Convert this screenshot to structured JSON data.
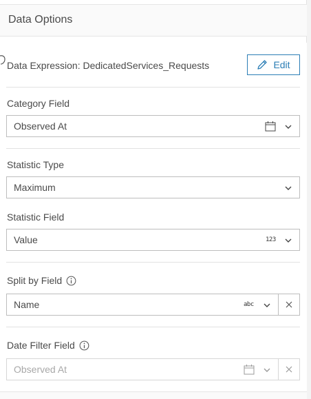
{
  "panel": {
    "title": "Data Options"
  },
  "expression": {
    "label": "Data Expression: DedicatedServices_Requests",
    "edit_label": "Edit"
  },
  "category_field": {
    "label": "Category Field",
    "value": "Observed At",
    "type_icon": "calendar-icon"
  },
  "statistic_type": {
    "label": "Statistic Type",
    "value": "Maximum"
  },
  "statistic_field": {
    "label": "Statistic Field",
    "value": "Value",
    "type_badge": "123"
  },
  "split_by_field": {
    "label": "Split by Field",
    "value": "Name",
    "type_badge": "abc"
  },
  "date_filter_field": {
    "label": "Date Filter Field",
    "value": "Observed At",
    "type_icon": "calendar-icon",
    "disabled": true
  },
  "colors": {
    "accent": "#2a7db5",
    "border": "#bdbdbd",
    "text": "#4a4a4a",
    "disabled_text": "#a8a8a8"
  }
}
